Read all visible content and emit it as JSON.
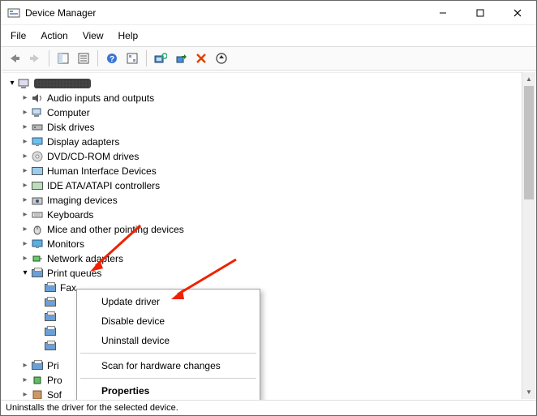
{
  "window": {
    "title": "Device Manager"
  },
  "menu": {
    "file": "File",
    "action": "Action",
    "view": "View",
    "help": "Help"
  },
  "tree": {
    "items": [
      {
        "label": "Audio inputs and outputs"
      },
      {
        "label": "Computer"
      },
      {
        "label": "Disk drives"
      },
      {
        "label": "Display adapters"
      },
      {
        "label": "DVD/CD-ROM drives"
      },
      {
        "label": "Human Interface Devices"
      },
      {
        "label": "IDE ATA/ATAPI controllers"
      },
      {
        "label": "Imaging devices"
      },
      {
        "label": "Keyboards"
      },
      {
        "label": "Mice and other pointing devices"
      },
      {
        "label": "Monitors"
      },
      {
        "label": "Network adapters"
      },
      {
        "label": "Print queues"
      },
      {
        "label": "Fax"
      }
    ],
    "truncated": [
      {
        "label": "Pri"
      },
      {
        "label": "Pro"
      },
      {
        "label": "Sof"
      }
    ]
  },
  "context_menu": {
    "update": "Update driver",
    "disable": "Disable device",
    "uninstall": "Uninstall device",
    "scan": "Scan for hardware changes",
    "properties": "Properties"
  },
  "statusbar": "Uninstalls the driver for the selected device."
}
